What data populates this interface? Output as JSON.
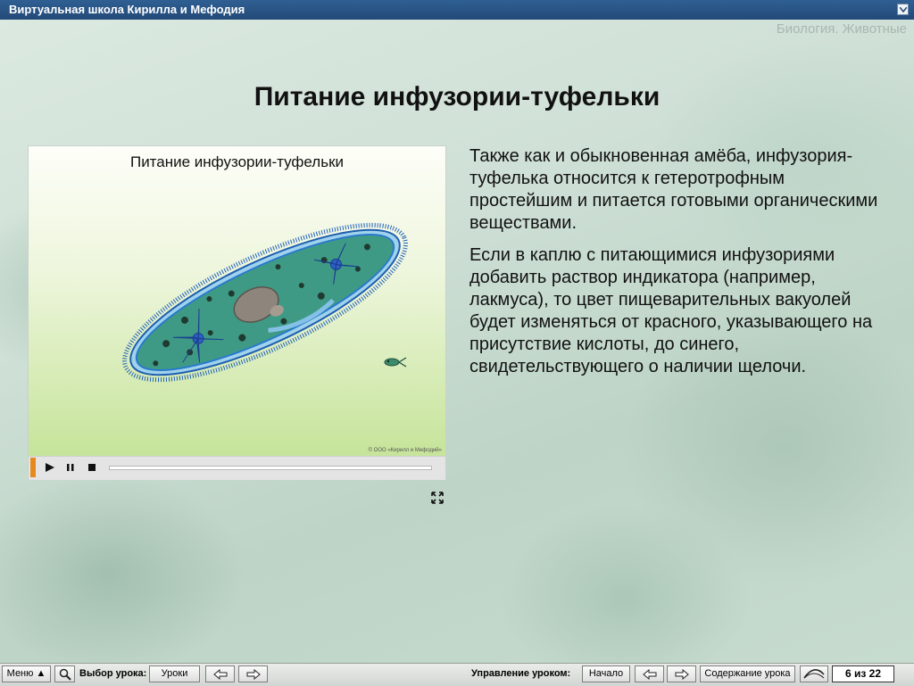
{
  "window": {
    "title": "Виртуальная школа Кирилла и Мефодия"
  },
  "subject": "Биология. Животные",
  "lesson": {
    "title": "Питание инфузории-туфельки",
    "paragraphs": [
      "Также как и обыкновенная амёба, инфузория-туфелька относится к гетеротрофным простейшим и питается готовыми органическими веществами.",
      "Если в каплю с питающимися инфузориями добавить раствор индикатора (например, лакмуса), то цвет пищеварительных вакуолей будет изменяться от красного, указывающего на присутствие кислоты, до синего, свидетельствующего о наличии щелочи."
    ]
  },
  "video": {
    "title": "Питание инфузории-туфельки",
    "copyright": "© ООО «Кирилл и Мефодий»",
    "progress": 0
  },
  "bottom_bar": {
    "menu_label": "Меню",
    "choose_lesson_label": "Выбор урока:",
    "lessons_button": "Уроки",
    "lesson_control_label": "Управление уроком:",
    "start_button": "Начало",
    "contents_button": "Содержание урока",
    "page_counter": "6 из 22"
  }
}
